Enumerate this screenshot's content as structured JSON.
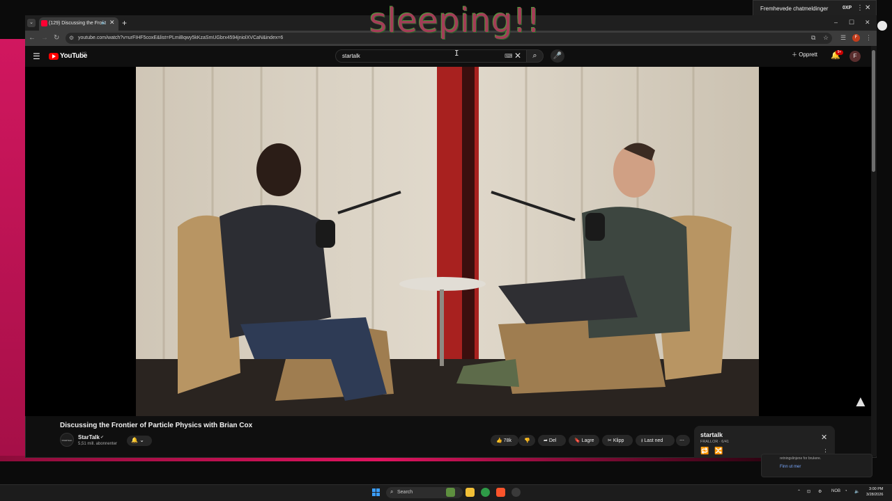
{
  "overlay": {
    "text": "sleeping!!"
  },
  "browser": {
    "tab_title": "(129) Discussing the Front",
    "url": "youtube.com/watch?v=urFIHF5coxE&list=PLmiBqwy5kKzaSmUGbrx4594jniolXVCaN&index=6",
    "window_controls": {
      "minimize": "–",
      "maximize": "☐",
      "close": "✕"
    },
    "profile_initial": "F"
  },
  "gamebar": {
    "chat_label": "Fremhevede chatmeldinger",
    "badge": "0XP"
  },
  "youtube": {
    "logo_text": "YouTube",
    "region": "NO",
    "search": {
      "value": "startalk"
    },
    "create_label": "Opprett",
    "notifications_count": "9+",
    "avatar_initial": "F"
  },
  "video": {
    "title": "Discussing the Frontier of Particle Physics with Brian Cox",
    "channel": "StarTalk",
    "channel_avatar_text": "STARTALK",
    "subscribers": "5,51 mill. abonnenter",
    "likes": "78k",
    "share_label": "Del",
    "save_label": "Lagre",
    "clip_label": "Klipp",
    "download_label": "Last ned"
  },
  "playlist": {
    "title": "startalk",
    "subtitle": "FRALLOR · 6/41"
  },
  "notification": {
    "text": "retningslinjene for brukere.",
    "link": "Finn ut mer"
  },
  "taskbar": {
    "search_label": "Search",
    "lang": "NOB",
    "time": "3:00 PM",
    "date": "3/28/2026"
  },
  "colors": {
    "brand_red": "#ff0000",
    "overlay_pink": "#a33d57",
    "start_blue": "#3b9dff"
  }
}
